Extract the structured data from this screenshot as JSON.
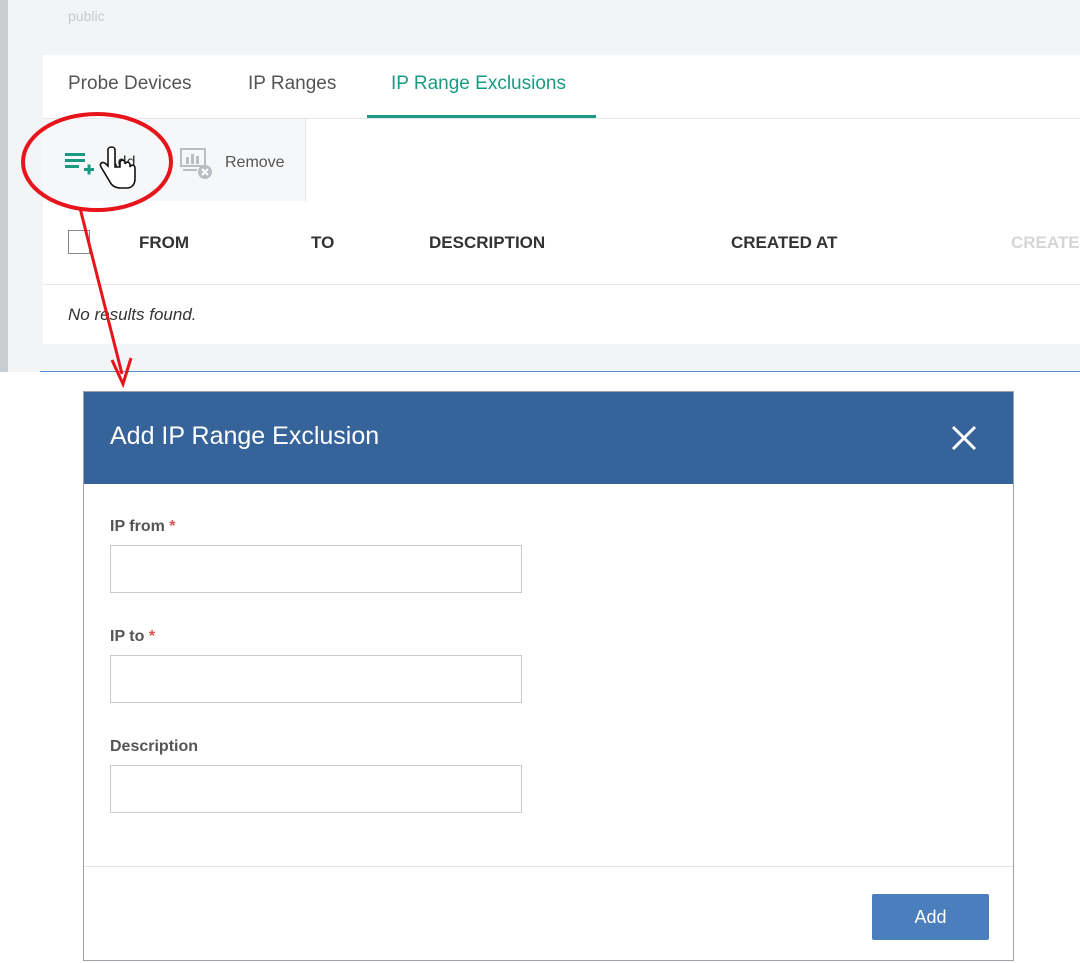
{
  "page": {
    "top_faded_text": "public"
  },
  "tabs": [
    {
      "label": "Probe Devices",
      "active": false
    },
    {
      "label": "IP Ranges",
      "active": false
    },
    {
      "label": "IP Range Exclusions",
      "active": true
    }
  ],
  "toolbar": {
    "add_label": "Add",
    "remove_label": "Remove",
    "add_icon": "list-add-icon",
    "remove_icon": "remove-icon"
  },
  "table": {
    "columns": [
      "FROM",
      "TO",
      "DESCRIPTION",
      "CREATED AT",
      "CREATE"
    ],
    "empty_message": "No results found."
  },
  "dialog": {
    "title": "Add IP Range Exclusion",
    "close_icon": "close-icon",
    "fields": [
      {
        "label": "IP from",
        "required": true,
        "value": "",
        "placeholder": ""
      },
      {
        "label": "IP to",
        "required": true,
        "value": "",
        "placeholder": ""
      },
      {
        "label": "Description",
        "required": false,
        "value": "",
        "placeholder": ""
      }
    ],
    "required_marker": "*",
    "submit_label": "Add"
  },
  "colors": {
    "accent_teal": "#1a9a83",
    "dialog_header": "#36649a",
    "button_blue": "#4a7ebd",
    "required_red": "#d9534f",
    "annotation_red": "#e8141b"
  }
}
